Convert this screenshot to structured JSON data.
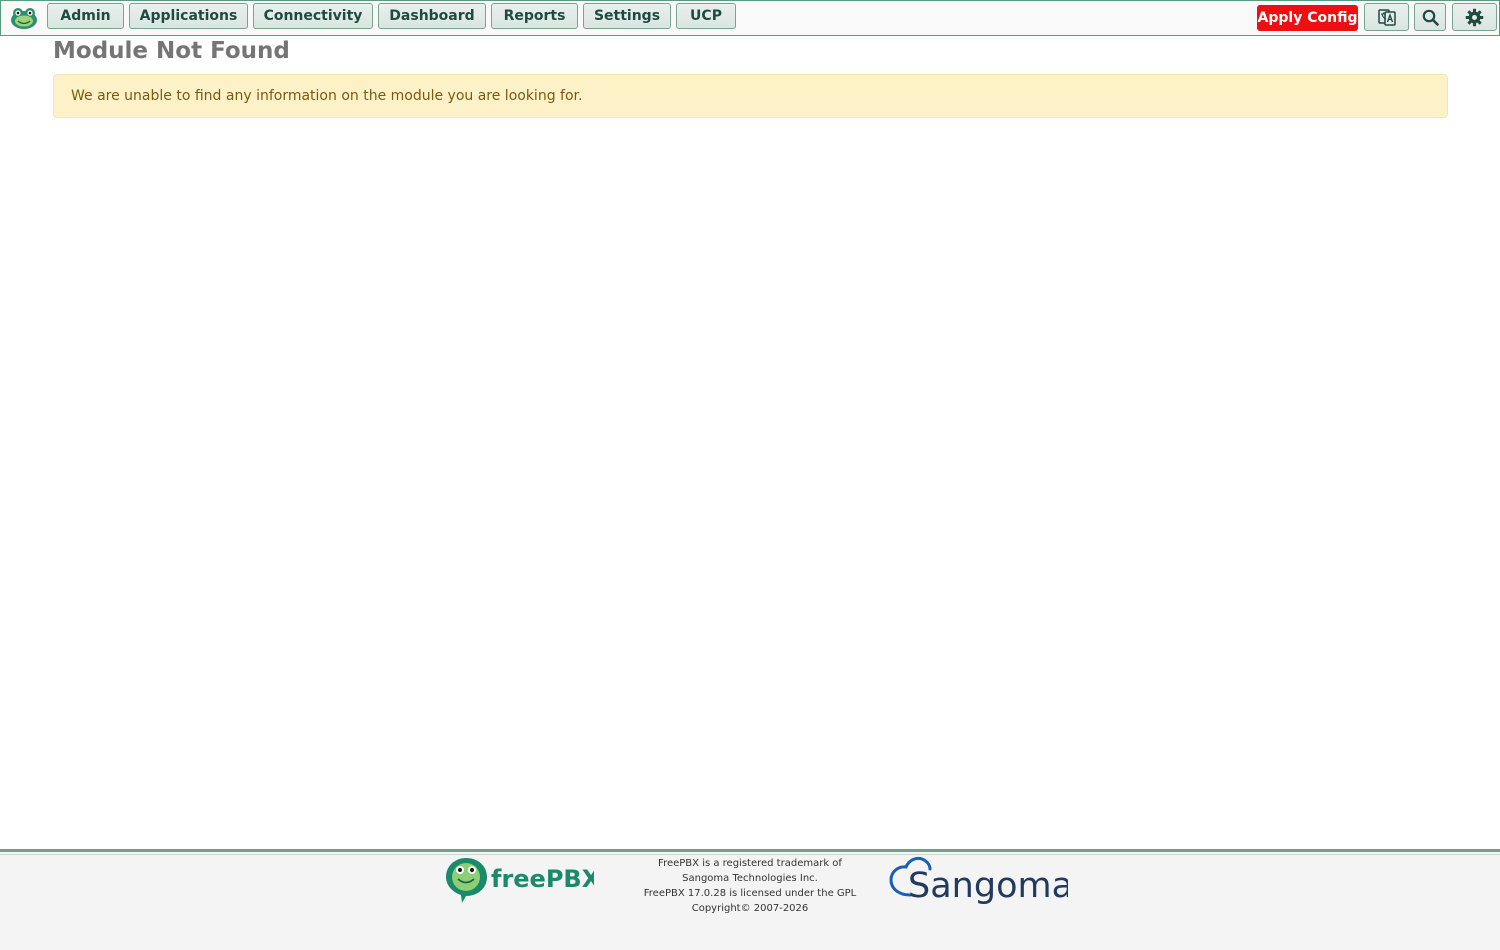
{
  "nav": {
    "items": [
      {
        "label": "Admin"
      },
      {
        "label": "Applications"
      },
      {
        "label": "Connectivity"
      },
      {
        "label": "Dashboard"
      },
      {
        "label": "Reports"
      },
      {
        "label": "Settings"
      },
      {
        "label": "UCP"
      }
    ],
    "apply_config_label": "Apply Config",
    "apply_config_color": "#ee1010",
    "icons": [
      "freepbx-frog-icon",
      "language-icon",
      "search-icon",
      "gear-icon"
    ]
  },
  "main": {
    "title": "Module Not Found",
    "alert": "We are unable to find any information on the module you are looking for."
  },
  "footer": {
    "freepbx_logo_text": "freePBX",
    "sangoma_logo_text": "Sangoma",
    "lines": [
      "FreePBX is a registered trademark of",
      "Sangoma Technologies Inc.",
      "FreePBX 17.0.28 is licensed under the GPL",
      "Copyright© 2007-2026"
    ]
  },
  "colors": {
    "brand_green": "#1b8a6b",
    "nav_text": "#1f4a40",
    "alert_bg": "#fdf1c8",
    "alert_text": "#7a5a12"
  }
}
